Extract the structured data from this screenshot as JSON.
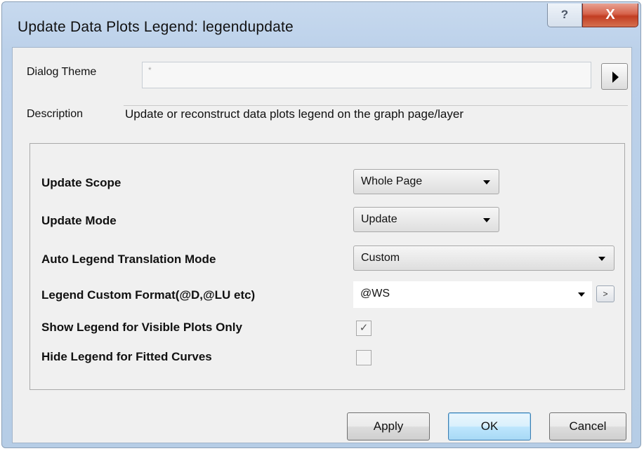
{
  "window": {
    "title": "Update Data Plots Legend: legendupdate",
    "help_glyph": "?",
    "close_glyph": "X"
  },
  "theme": {
    "label": "Dialog Theme",
    "value": "*",
    "arrow_icon": "right-triangle-icon"
  },
  "description": {
    "label": "Description",
    "text": "Update or reconstruct data plots legend on the graph page/layer"
  },
  "params": {
    "update_scope": {
      "label": "Update Scope",
      "value": "Whole Page"
    },
    "update_mode": {
      "label": "Update Mode",
      "value": "Update"
    },
    "translation_mode": {
      "label": "Auto Legend Translation Mode",
      "value": "Custom"
    },
    "custom_format": {
      "label": "Legend Custom Format(@D,@LU etc)",
      "value": "@WS",
      "expand_glyph": ">"
    },
    "visible_only": {
      "label": "Show Legend for Visible Plots Only",
      "checked": true,
      "mark": "✓"
    },
    "hide_fitted": {
      "label": "Hide Legend for Fitted Curves",
      "checked": false,
      "mark": ""
    }
  },
  "buttons": {
    "apply": "Apply",
    "ok": "OK",
    "cancel": "Cancel"
  },
  "colors": {
    "frame": "#bcd1ea",
    "close_button": "#c23d22",
    "default_button_border": "#3c7fb1"
  }
}
